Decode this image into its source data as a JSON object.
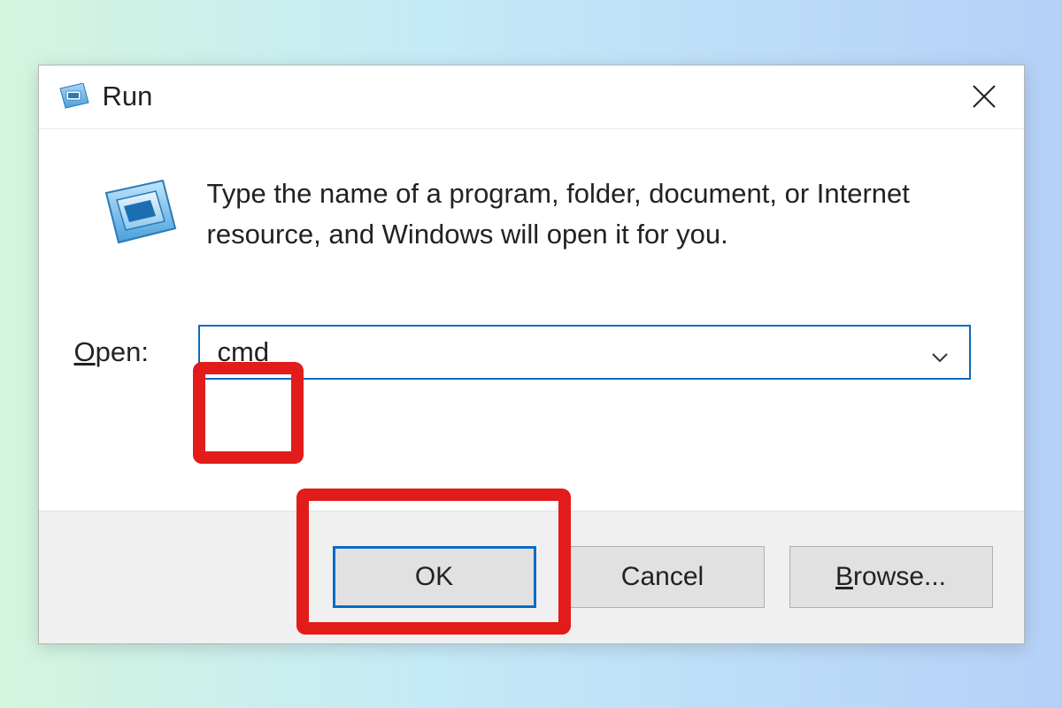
{
  "titlebar": {
    "title": "Run"
  },
  "content": {
    "description": "Type the name of a program, folder, document, or Internet resource, and Windows will open it for you.",
    "open_label_prefix": "O",
    "open_label_rest": "pen:",
    "input_value": "cmd"
  },
  "buttons": {
    "ok": "OK",
    "cancel": "Cancel",
    "browse_prefix": "B",
    "browse_rest": "rowse..."
  }
}
